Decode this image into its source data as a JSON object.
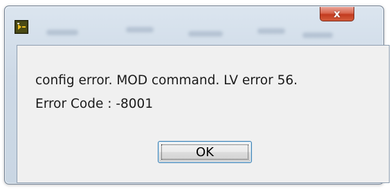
{
  "window": {
    "icon": "labview-vi-icon",
    "close_label": "x"
  },
  "dialog": {
    "message_line1": "config error. MOD command. LV error 56.",
    "message_line2": "Error Code : -8001",
    "ok_label": "OK"
  },
  "colors": {
    "frame": "#cdd9e6",
    "close_button": "#c9452b",
    "content_background": "#f0f0f0",
    "ok_border": "#3c7fb1"
  }
}
